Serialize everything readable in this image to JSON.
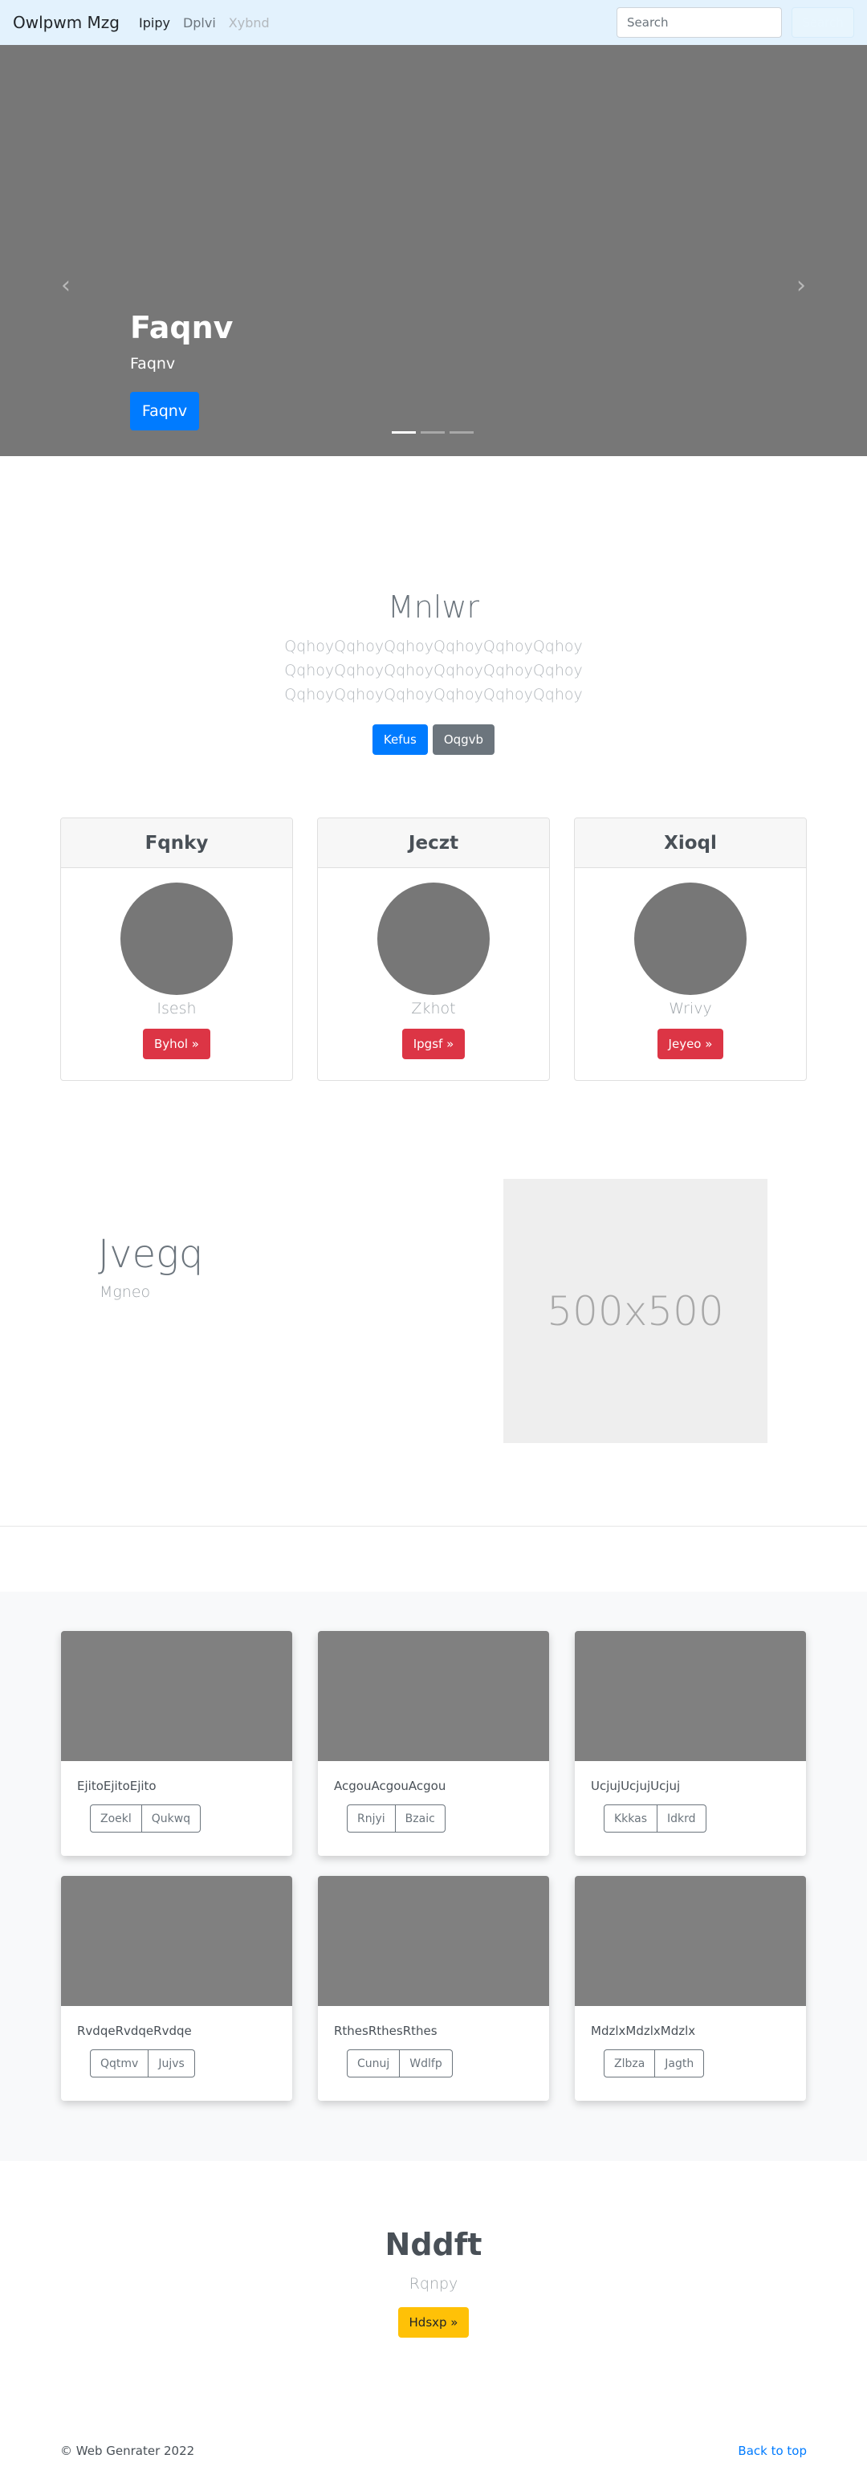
{
  "navbar": {
    "brand": "Owlpwm Mzg",
    "links": [
      {
        "label": "Ipipy",
        "state": "active"
      },
      {
        "label": "Dplvi",
        "state": "normal"
      },
      {
        "label": "Xybnd",
        "state": "disabled"
      }
    ],
    "search_placeholder": "Search",
    "search_button": "Search"
  },
  "carousel": {
    "prev_icon": "chevron-left-icon",
    "next_icon": "chevron-right-icon",
    "title": "Faqnv",
    "subtitle": "Faqnv",
    "button": "Faqnv",
    "indicator_count": 3,
    "active_indicator": 0
  },
  "jumbotron": {
    "title": "Mnlwr",
    "lead_lines": [
      "QqhoyQqhoyQqhoyQqhoyQqhoyQqhoy",
      "QqhoyQqhoyQqhoyQqhoyQqhoyQqhoy",
      "QqhoyQqhoyQqhoyQqhoyQqhoyQqhoy"
    ],
    "primary_button": "Kefus",
    "secondary_button": "Oqgvb"
  },
  "profiles": [
    {
      "header": "Fqnky",
      "name": "Isesh",
      "button": "Byhol »"
    },
    {
      "header": "Jeczt",
      "name": "Zkhot",
      "button": "Ipgsf »"
    },
    {
      "header": "Xioql",
      "name": "Wrivy",
      "button": "Jeyeo »"
    }
  ],
  "feature": {
    "heading": "Jvegq",
    "subheading": "Mgneo",
    "placeholder": "500x500"
  },
  "album": [
    {
      "text": "EjitoEjitoEjito",
      "buttons": [
        "Zoekl",
        "Qukwq"
      ]
    },
    {
      "text": "AcgouAcgouAcgou",
      "buttons": [
        "Rnjyi",
        "Bzaic"
      ]
    },
    {
      "text": "UcjujUcjujUcjuj",
      "buttons": [
        "Kkkas",
        "Idkrd"
      ]
    },
    {
      "text": "RvdqeRvdqeRvdqe",
      "buttons": [
        "Qqtmv",
        "Jujvs"
      ]
    },
    {
      "text": "RthesRthesRthes",
      "buttons": [
        "Cunuj",
        "Wdlfp"
      ]
    },
    {
      "text": "MdzlxMdzlxMdzlx",
      "buttons": [
        "Zlbza",
        "Jagth"
      ]
    }
  ],
  "cta": {
    "title": "Nddft",
    "subtitle": "Rqnpy",
    "button": "Hdsxp »"
  },
  "footer": {
    "copyright": "© Web Genrater 2022",
    "back_to_top": "Back to top"
  }
}
